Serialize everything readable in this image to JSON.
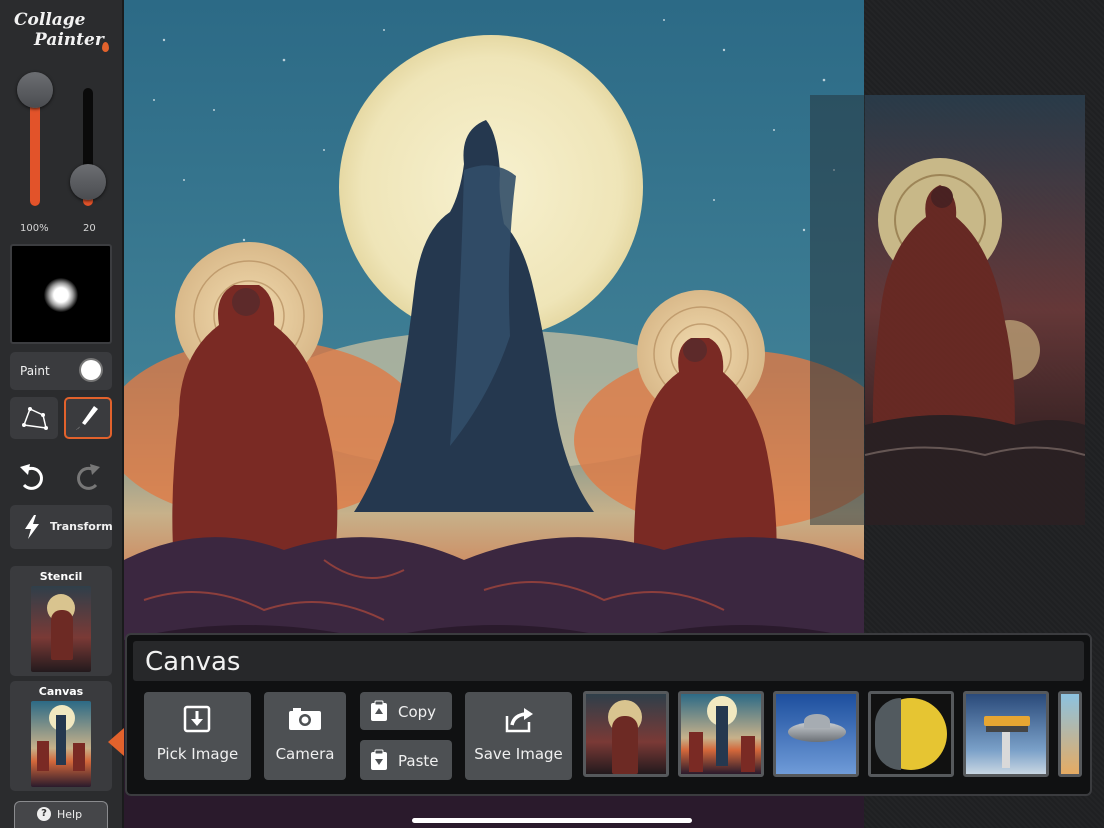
{
  "app": {
    "logo_line1": "Collage",
    "logo_line2": "Painter"
  },
  "sliders": {
    "opacity_label": "100%",
    "size_label": "20",
    "opacity_fraction": 1.0,
    "size_fraction": 0.18
  },
  "brush": {
    "mode_label": "Paint"
  },
  "tools": {
    "transform_label": "Transform"
  },
  "thumbnails": {
    "stencil_label": "Stencil",
    "canvas_label": "Canvas"
  },
  "help": {
    "label": "Help",
    "icon": "?"
  },
  "canvas_panel": {
    "title": "Canvas",
    "pick_image": "Pick Image",
    "camera": "Camera",
    "copy": "Copy",
    "paste": "Paste",
    "save_image": "Save Image"
  },
  "colors": {
    "accent": "#e2622c",
    "panel": "#3a3b3e",
    "sidebar": "#2b2c2e"
  },
  "icons": [
    "polygon-lasso-icon",
    "brush-icon",
    "undo-icon",
    "redo-icon",
    "lightning-icon",
    "download-icon",
    "camera-icon",
    "clipboard-copy-icon",
    "clipboard-paste-icon",
    "share-icon",
    "help-icon"
  ]
}
